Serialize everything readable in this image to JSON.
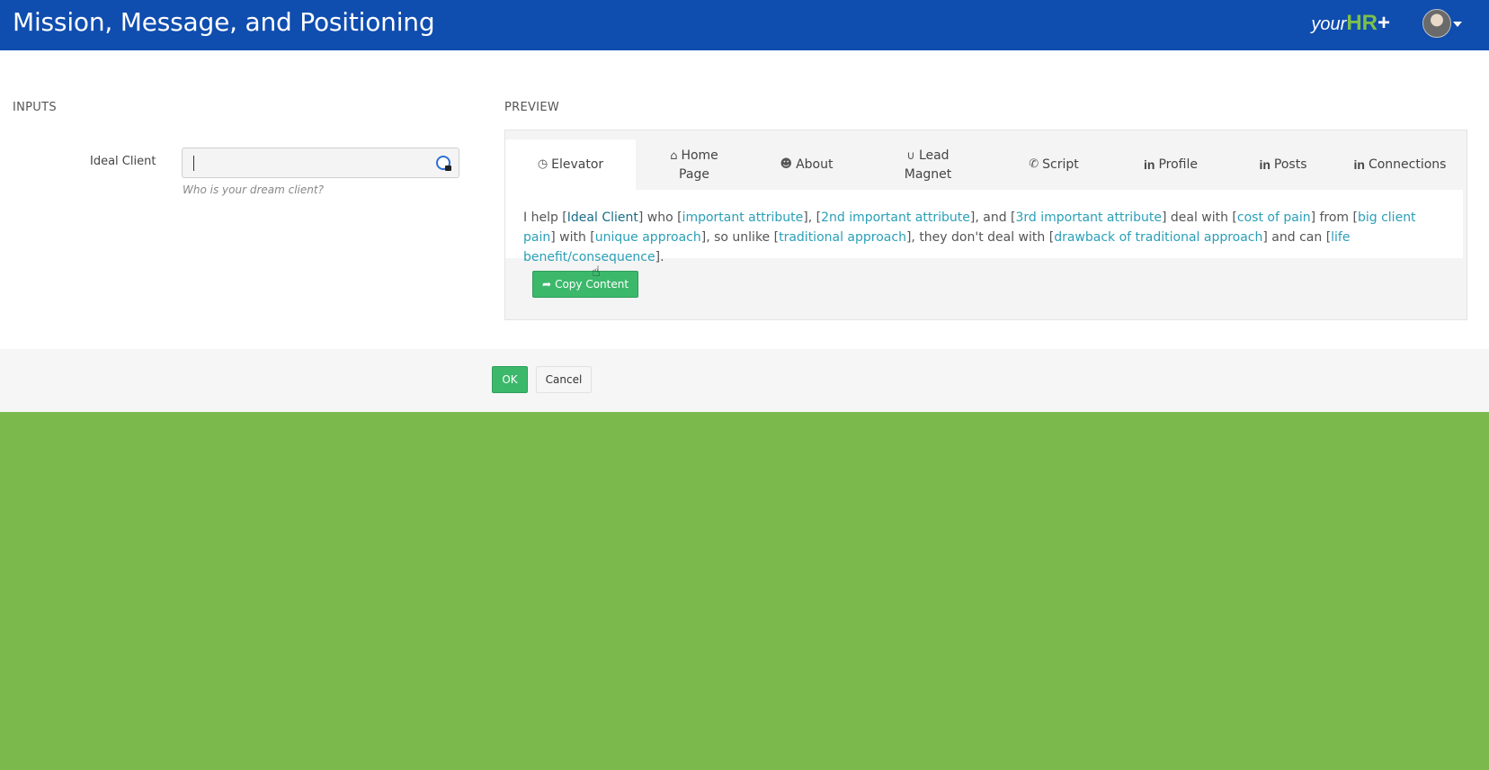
{
  "header": {
    "title": "Mission, Message, and Positioning",
    "brand": {
      "prefix": "your",
      "hr": "HR",
      "plus": "+"
    }
  },
  "inputs": {
    "section_label": "INPUTS",
    "ideal_client": {
      "label": "Ideal Client",
      "value": "",
      "help": "Who is your dream client?"
    }
  },
  "preview": {
    "section_label": "PREVIEW",
    "tabs": [
      {
        "label": "Elevator",
        "icon": "clock-icon",
        "active": true
      },
      {
        "label_line1": "Home",
        "label_line2": "Page",
        "icon": "home-icon"
      },
      {
        "label": "About",
        "icon": "user-icon"
      },
      {
        "label_line1": "Lead",
        "label_line2": "Magnet",
        "icon": "magnet-icon"
      },
      {
        "label": "Script",
        "icon": "phone-icon"
      },
      {
        "label": "Profile",
        "icon": "linkedin-icon"
      },
      {
        "label": "Posts",
        "icon": "linkedin-icon"
      },
      {
        "label": "Connections",
        "icon": "linkedin-icon"
      }
    ],
    "text": {
      "t0": "I help [",
      "p0": "Ideal Client",
      "t1": "] who [",
      "p1": "important attribute",
      "t2": "], [",
      "p2": "2nd important attribute",
      "t3": "], and [",
      "p3": "3rd important attribute",
      "t4": "] deal with [",
      "p4": "cost of pain",
      "t5": "] from [",
      "p5": "big client pain",
      "t6": "] with [",
      "p6": "unique approach",
      "t7": "], so unlike [",
      "p7": "traditional approach",
      "t8": "], they don't deal with [",
      "p8": "drawback of traditional approach",
      "t9": "] and can [",
      "p9": "life benefit/consequence",
      "t10": "]."
    },
    "copy_label": "Copy Content"
  },
  "actions": {
    "ok_label": "OK",
    "cancel_label": "Cancel"
  },
  "colors": {
    "header_bg": "#0f4daf",
    "page_bg": "#7cb94d",
    "accent_green": "#3cb86b",
    "placeholder_link": "#2a9fb8"
  }
}
